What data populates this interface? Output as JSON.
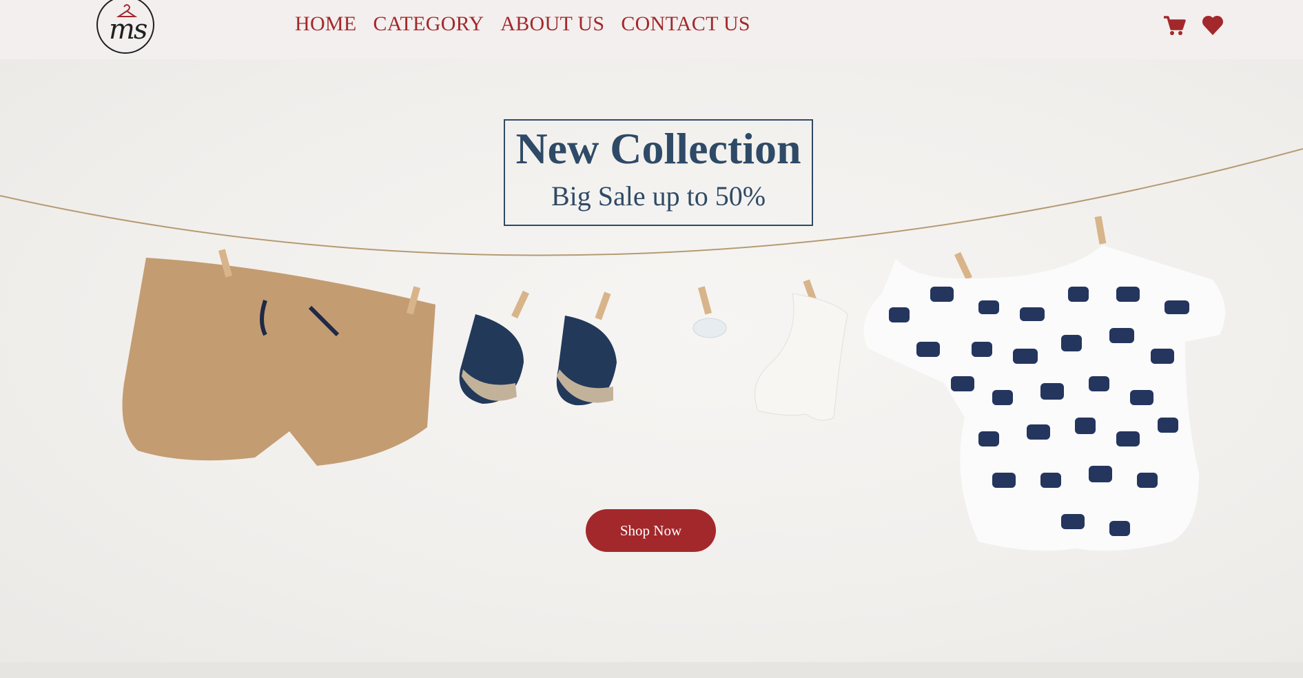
{
  "logo": {
    "text": "ms"
  },
  "nav": {
    "items": [
      {
        "label": "HOME"
      },
      {
        "label": "CATEGORY"
      },
      {
        "label": "ABOUT US"
      },
      {
        "label": "CONTACT US"
      }
    ]
  },
  "header_icons": [
    "cart-icon",
    "heart-icon"
  ],
  "hero": {
    "title": "New Collection",
    "subtitle": "Big Sale up to 50%",
    "button_label": "Shop Now"
  },
  "colors": {
    "accent": "#a3282b",
    "navy": "#2e4a66",
    "header_bg": "#f2efee"
  }
}
